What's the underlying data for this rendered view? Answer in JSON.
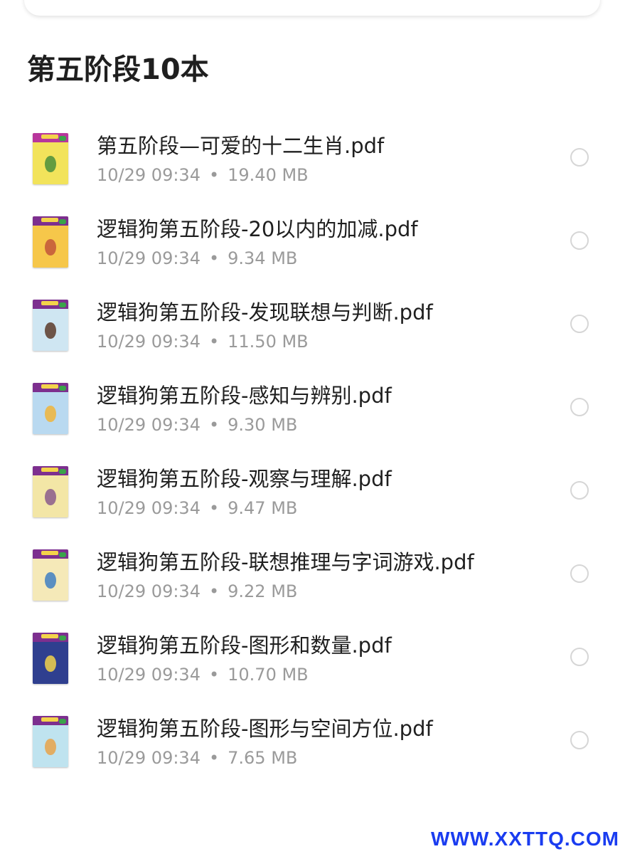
{
  "section": {
    "title": "第五阶段10本"
  },
  "files": [
    {
      "name": "第五阶段—可爱的十二生肖.pdf",
      "date": "10/29 09:34",
      "size": "19.40 MB",
      "thumb_icon": "pdf-cover-thumbnail",
      "cover_band": "#b8369c",
      "cover_bg": "#f2e35b",
      "cover_art": "#4a8f3c"
    },
    {
      "name": "逻辑狗第五阶段-20以内的加减.pdf",
      "date": "10/29 09:34",
      "size": "9.34 MB",
      "thumb_icon": "pdf-cover-thumbnail",
      "cover_band": "#7d2f8f",
      "cover_bg": "#f6c74a",
      "cover_art": "#c2553a"
    },
    {
      "name": "逻辑狗第五阶段-发现联想与判断.pdf",
      "date": "10/29 09:34",
      "size": "11.50 MB",
      "thumb_icon": "pdf-cover-thumbnail",
      "cover_band": "#7d2f8f",
      "cover_bg": "#cfe6f2",
      "cover_art": "#5c3a2a"
    },
    {
      "name": "逻辑狗第五阶段-感知与辨别.pdf",
      "date": "10/29 09:34",
      "size": "9.30 MB",
      "thumb_icon": "pdf-cover-thumbnail",
      "cover_band": "#7d2f8f",
      "cover_bg": "#b9d9f0",
      "cover_art": "#f0b43a"
    },
    {
      "name": "逻辑狗第五阶段-观察与理解.pdf",
      "date": "10/29 09:34",
      "size": "9.47 MB",
      "thumb_icon": "pdf-cover-thumbnail",
      "cover_band": "#7d2f8f",
      "cover_bg": "#f3e6a6",
      "cover_art": "#8a5a8c"
    },
    {
      "name": "逻辑狗第五阶段-联想推理与字词游戏.pdf",
      "date": "10/29 09:34",
      "size": "9.22 MB",
      "thumb_icon": "pdf-cover-thumbnail",
      "cover_band": "#7d2f8f",
      "cover_bg": "#f5e9b8",
      "cover_art": "#3f7fc2"
    },
    {
      "name": "逻辑狗第五阶段-图形和数量.pdf",
      "date": "10/29 09:34",
      "size": "10.70 MB",
      "thumb_icon": "pdf-cover-thumbnail",
      "cover_band": "#7d2f8f",
      "cover_bg": "#2f3f8f",
      "cover_art": "#f2d24a"
    },
    {
      "name": "逻辑狗第五阶段-图形与空间方位.pdf",
      "date": "10/29 09:34",
      "size": "7.65 MB",
      "thumb_icon": "pdf-cover-thumbnail",
      "cover_band": "#7d2f8f",
      "cover_bg": "#bfe3ef",
      "cover_art": "#e7a34a"
    }
  ],
  "watermark": "WWW.XXTTQ.COM"
}
